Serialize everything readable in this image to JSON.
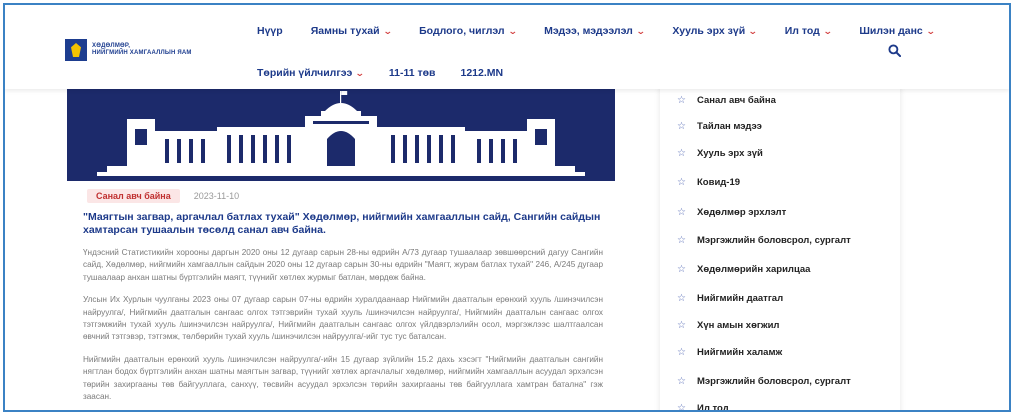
{
  "logo": {
    "text_line1": "ХӨДӨЛМӨР,",
    "text_line2": "НИЙГМИЙН ХАМГААЛЛЫН ЯАМ"
  },
  "nav": {
    "row1": [
      {
        "label": "Нүүр",
        "dropdown": false
      },
      {
        "label": "Яамны тухай",
        "dropdown": true
      },
      {
        "label": "Бодлого, чиглэл",
        "dropdown": true
      },
      {
        "label": "Мэдээ, мэдээлэл",
        "dropdown": true
      },
      {
        "label": "Хууль эрх зүй",
        "dropdown": true
      },
      {
        "label": "Ил тод",
        "dropdown": true
      },
      {
        "label": "Шилэн данс",
        "dropdown": true
      }
    ],
    "row2": [
      {
        "label": "Төрийн үйлчилгээ",
        "dropdown": true
      },
      {
        "label": "11-11 төв",
        "dropdown": false
      },
      {
        "label": "1212.MN",
        "dropdown": false
      }
    ],
    "search_icon": "search-icon"
  },
  "article": {
    "badge": "Санал авч байна",
    "date": "2023-11-10",
    "title": "\"Маягтын загвар, аргачлал батлах тухай\" Хөдөлмөр, нийгмийн хамгааллын сайд, Сангийн сайдын хамтарсан тушаалын төсөлд санал авч байна.",
    "paragraphs": [
      "Үндэсний Статистикийн хорооны даргын 2020 оны 12 дугаар сарын 28-ны өдрийн А/73 дугаар тушаалаар зөвшөөрсний дагуу Сангийн сайд, Хөдөлмөр, нийгмийн хамгааллын сайдын 2020 оны 12 дугаар сарын 30-ны өдрийн \"Маягт, журам батлах тухай\" 246, А/245 дугаар тушаалаар анхан шатны бүртгэлийн маягт, түүнийг хөтлөх журмыг батлан, мөрдөж байна.",
      "Улсын Их Хурлын чуулганы 2023 оны 07 дугаар сарын 07-ны өдрийн хуралдаанаар Нийгмийн даатгалын ерөнхий хууль /шинэчилсэн найруулга/, Нийгмийн даатгалын сангаас олгох тэтгэврийн тухай хууль /шинэчилсэн найруулга/, Нийгмийн даатгалын сангаас олгох тэтгэмжийн тухай хууль /шинэчилсэн найруулга/, Нийгмийн даатгалын сангаас олгох үйлдвэрлэлийн осол, мэргэжлээс шалтгаалсан өвчний тэтгэвэр, тэтгэмж, төлбөрийн тухай хууль /шинэчилсэн найруулга/-ийг тус тус баталсан.",
      "Нийгмийн даатгалын ерөнхий хууль /шинэчилсэн найруулга/-ийн 15 дугаар зүйлийн 15.2 дахь хэсэгт \"Нийгмийн даатгалын сангийн нягтлан бодох бүртгэлийн анхан шатны маягтын загвар, түүнийг хөтлөх аргачлалыг хөдөлмөр, нийгмийн хамгааллын асуудал эрхэлсэн төрийн захиргааны төв байгууллага, санхүү, төсвийн асуудал эрхэлсэн төрийн захиргааны төв байгууллага хамтран батална\" гэж заасан."
    ]
  },
  "sidebar": {
    "items": [
      "Санал авч байна",
      "Тайлан мэдээ",
      "Хууль эрх зүй",
      "Ковид-19",
      "Хөдөлмөр эрхлэлт",
      "Мэргэжлийн боловсрол, сургалт",
      "Хөдөлмөрийн харилцаа",
      "Нийгмийн даатгал",
      "Хүн амын хөгжил",
      "Нийгмийн халамж",
      "Мэргэжлийн боловсрол, сургалт",
      "Ил тод"
    ]
  },
  "colors": {
    "primary": "#1d3a8a",
    "accent_red": "#d23b3b",
    "banner_bg": "#1c2a6b"
  }
}
